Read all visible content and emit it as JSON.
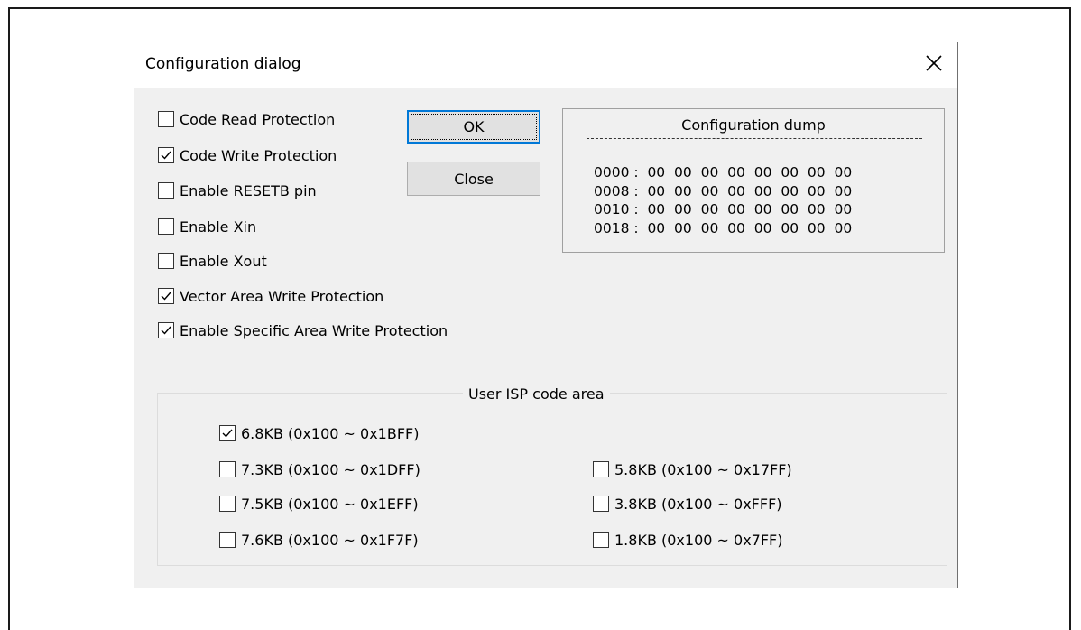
{
  "dialog": {
    "title": "Configuration dialog"
  },
  "options": [
    {
      "label": "Code Read Protection",
      "checked": false
    },
    {
      "label": "Code Write Protection",
      "checked": true
    },
    {
      "label": "Enable RESETB pin",
      "checked": false
    },
    {
      "label": "Enable Xin",
      "checked": false
    },
    {
      "label": "Enable Xout",
      "checked": false
    },
    {
      "label": "Vector Area Write Protection",
      "checked": true
    },
    {
      "label": "Enable Specific Area Write Protection",
      "checked": true
    }
  ],
  "buttons": {
    "ok": "OK",
    "close": "Close"
  },
  "dump": {
    "title": "Configuration dump",
    "lines": [
      "0000 :  00  00  00  00  00  00  00  00",
      "0008 :  00  00  00  00  00  00  00  00",
      "0010 :  00  00  00  00  00  00  00  00",
      "0018 :  00  00  00  00  00  00  00  00"
    ]
  },
  "isp_area": {
    "title": "User ISP code area",
    "options": [
      {
        "label": "6.8KB (0x100 ~ 0x1BFF)",
        "checked": true
      },
      {
        "label": "7.3KB (0x100 ~ 0x1DFF)",
        "checked": false
      },
      {
        "label": "7.5KB (0x100 ~ 0x1EFF)",
        "checked": false
      },
      {
        "label": "7.6KB (0x100 ~ 0x1F7F)",
        "checked": false
      },
      {
        "label": "5.8KB (0x100 ~ 0x17FF)",
        "checked": false
      },
      {
        "label": "3.8KB (0x100 ~ 0xFFF)",
        "checked": false
      },
      {
        "label": "1.8KB (0x100 ~ 0x7FF)",
        "checked": false
      }
    ]
  },
  "icons": {
    "close": "close-icon",
    "check": "checkmark-icon"
  }
}
